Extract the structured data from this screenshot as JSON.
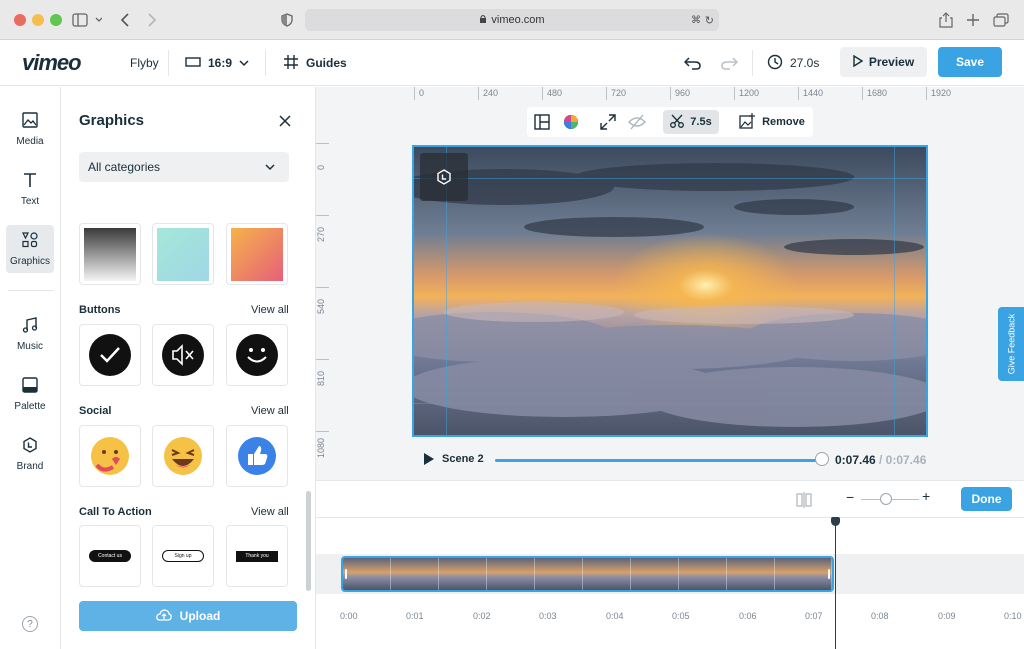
{
  "browser": {
    "url": "vimeo.com"
  },
  "app": {
    "logo": "vimeo",
    "project_name": "Flyby",
    "aspect_ratio": "16:9",
    "guides_label": "Guides",
    "duration": "27.0s",
    "preview_label": "Preview",
    "save_label": "Save",
    "accent": "#3aa3e3"
  },
  "rail": {
    "items": [
      {
        "label": "Media",
        "icon": "image-icon"
      },
      {
        "label": "Text",
        "icon": "text-icon"
      },
      {
        "label": "Graphics",
        "icon": "shapes-icon"
      },
      {
        "label": "Music",
        "icon": "music-icon"
      },
      {
        "label": "Palette",
        "icon": "palette-icon"
      },
      {
        "label": "Brand",
        "icon": "brand-icon"
      }
    ],
    "active": "Graphics"
  },
  "panel": {
    "title": "Graphics",
    "category_select": "All categories",
    "sections": [
      {
        "title": "Buttons",
        "view_all": "View all"
      },
      {
        "title": "Social",
        "view_all": "View all"
      },
      {
        "title": "Call To Action",
        "view_all": "View all"
      }
    ],
    "cta": [
      "Contact us",
      "Sign up",
      "Thank you"
    ],
    "upload_label": "Upload"
  },
  "ruler": {
    "h": [
      "0",
      "240",
      "480",
      "720",
      "960",
      "1200",
      "1440",
      "1680",
      "1920"
    ],
    "v": [
      "0",
      "270",
      "540",
      "810",
      "1080"
    ]
  },
  "canvas_toolbar": {
    "trim_duration": "7.5s",
    "remove_label": "Remove"
  },
  "player": {
    "scene": "Scene 2",
    "current_time": "0:07.46",
    "total_time": "/ 0:07.46",
    "progress": 1.0
  },
  "timeline": {
    "done_label": "Done",
    "labels": [
      "0:00",
      "0:01",
      "0:02",
      "0:03",
      "0:04",
      "0:05",
      "0:06",
      "0:07",
      "0:08",
      "0:09",
      "0:10"
    ]
  },
  "feedback_label": "Give Feedback"
}
